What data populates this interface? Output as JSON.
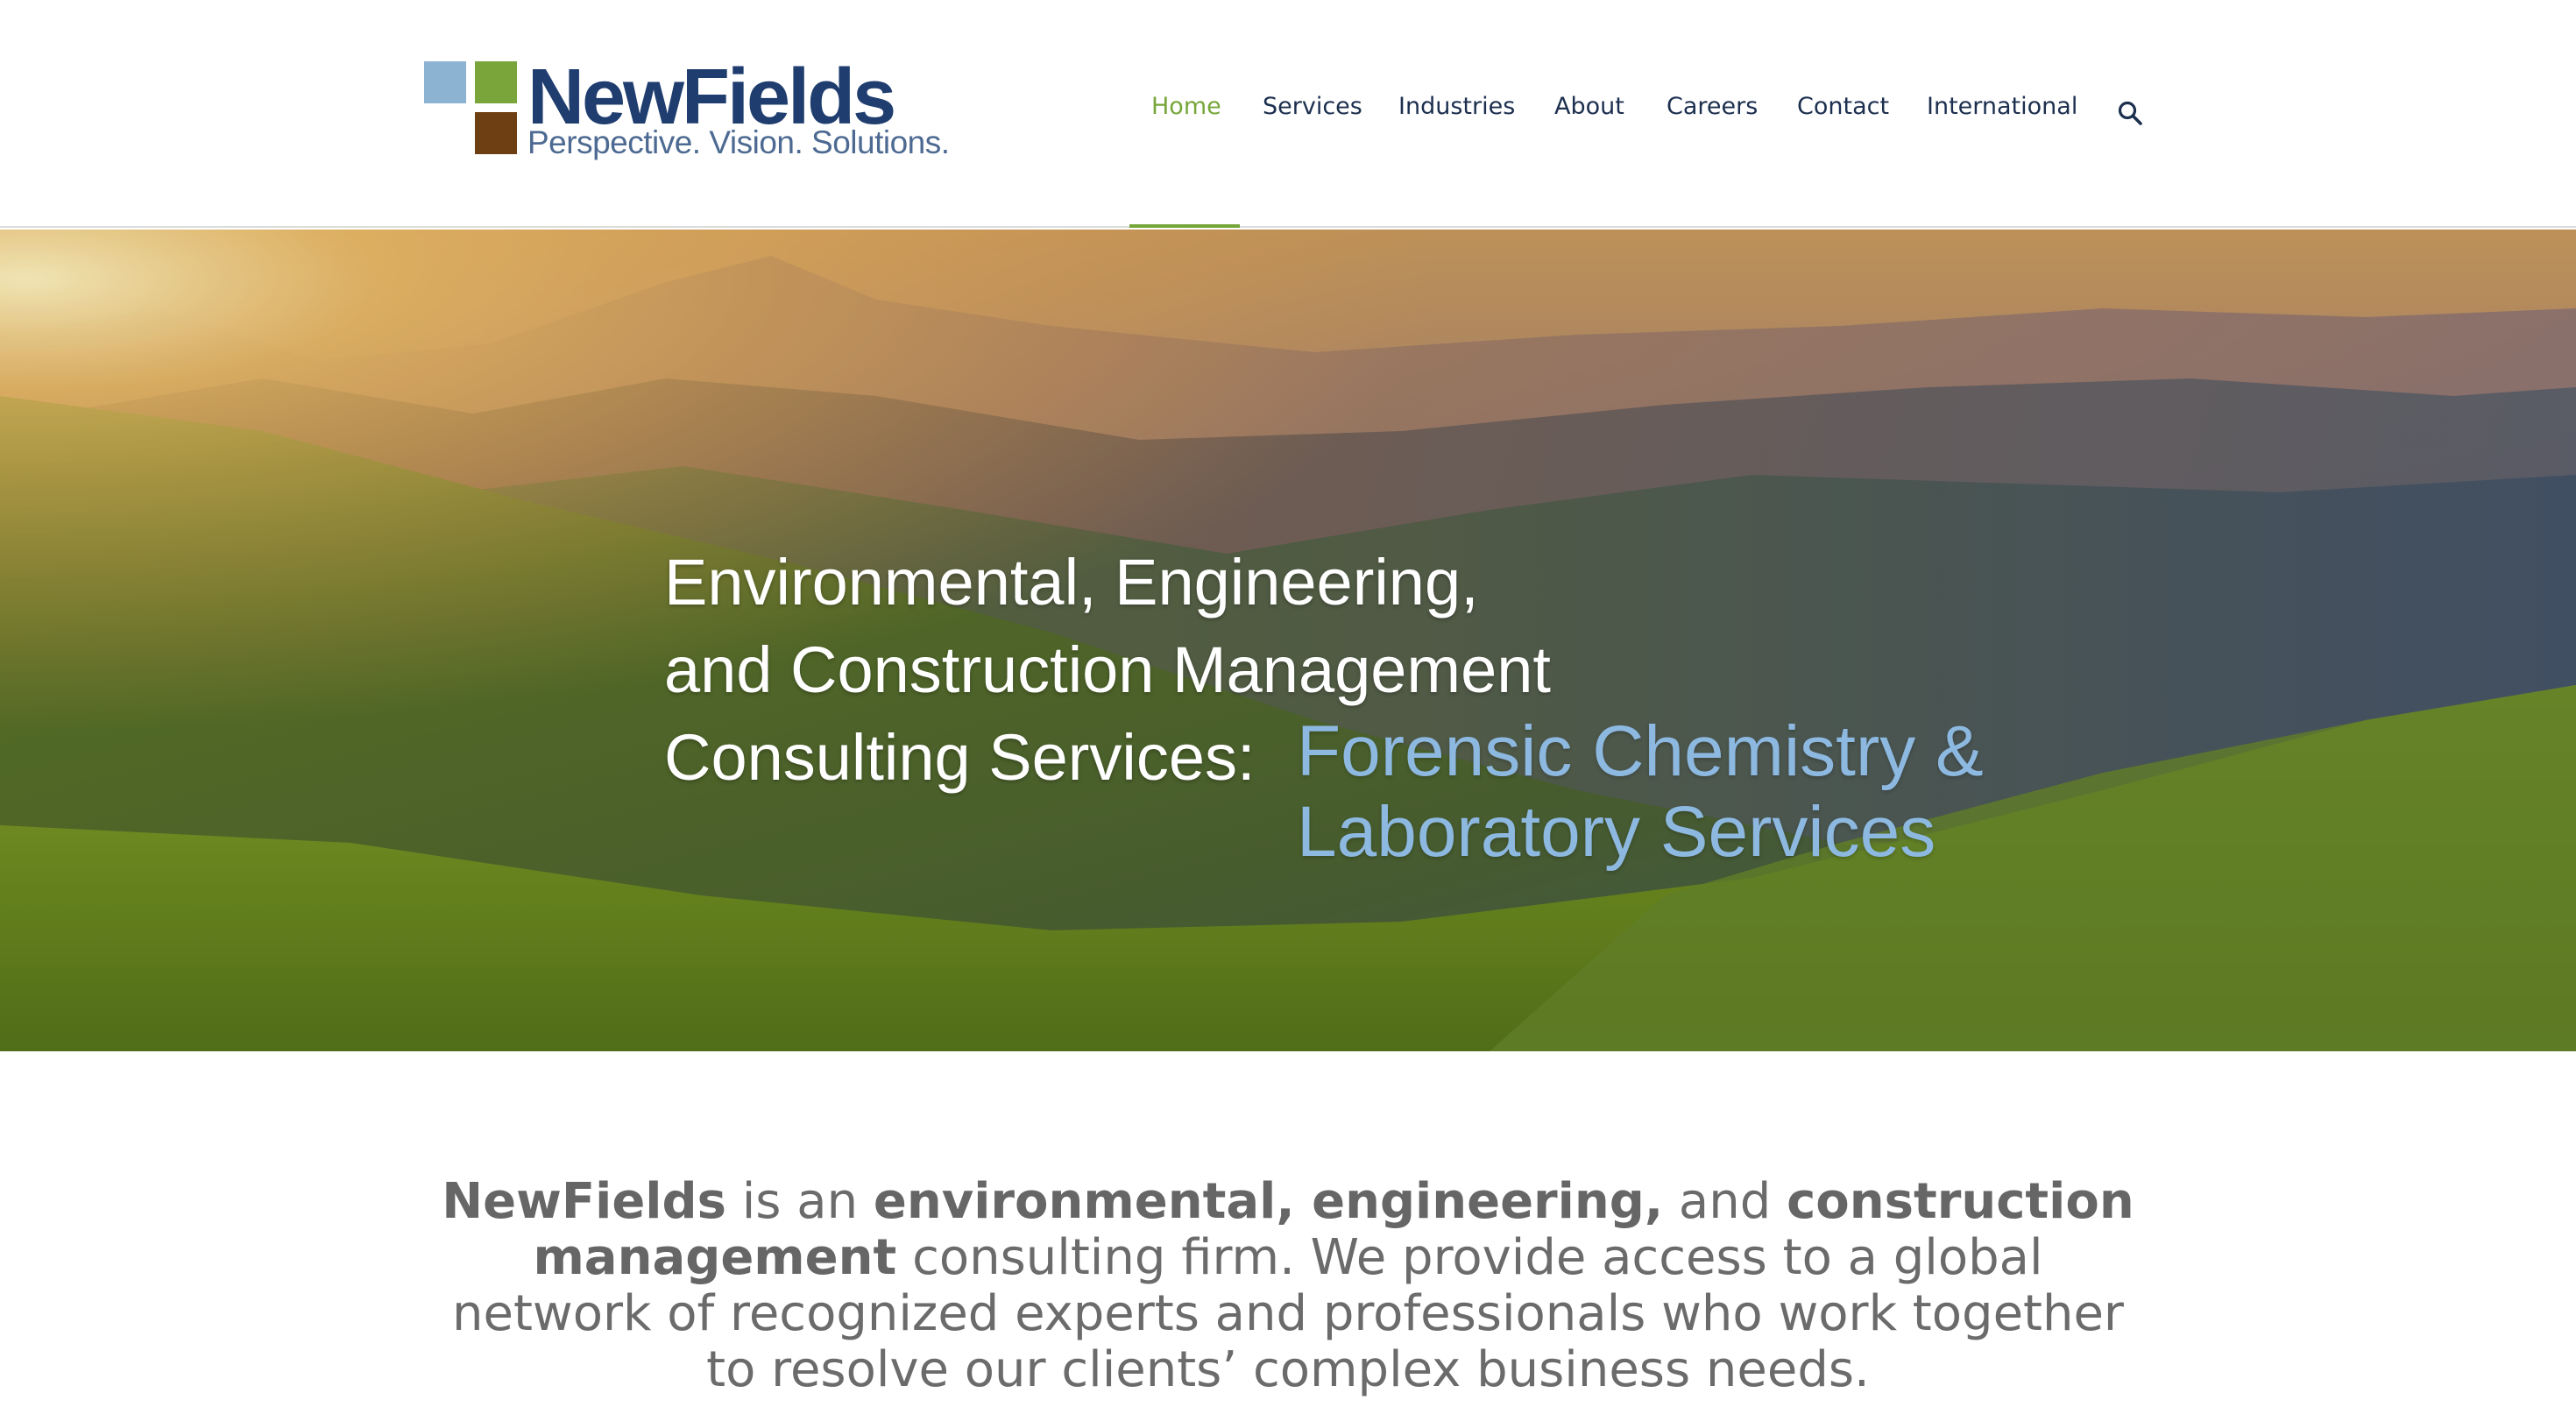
{
  "brand": {
    "name": "NewFields",
    "tagline": "Perspective. Vision. Solutions.",
    "colors": {
      "blue": "#8db3d2",
      "green": "#7aa53a",
      "brown": "#6e3f12",
      "navy": "#1f3d6e"
    }
  },
  "nav": {
    "items": [
      {
        "label": "Home",
        "active": true
      },
      {
        "label": "Services",
        "active": false
      },
      {
        "label": "Industries",
        "active": false
      },
      {
        "label": "About",
        "active": false
      },
      {
        "label": "Careers",
        "active": false
      },
      {
        "label": "Contact",
        "active": false
      },
      {
        "label": "International",
        "active": false
      }
    ],
    "search_icon": "search-icon",
    "active_color": "#76a63a"
  },
  "hero": {
    "line1": "Environmental, Engineering,",
    "line2": "and Construction Management",
    "line3": "Consulting Services:",
    "accent_line1": "Forensic Chemistry &",
    "accent_line2": "Laboratory Services",
    "accent_color": "#8db8e0"
  },
  "intro": {
    "name": "NewFields",
    "t1": " is an ",
    "b1": "environmental, engineering,",
    "t2": " and ",
    "b2": "construction management",
    "t3": " consulting firm. We provide access to a global network of recognized experts and professionals who work together to resolve our clients’ complex business needs."
  }
}
